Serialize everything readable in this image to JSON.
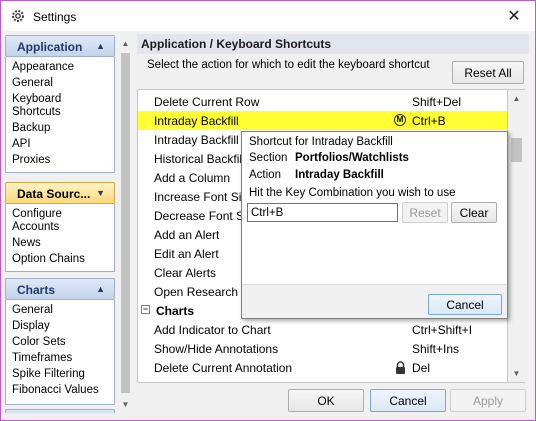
{
  "window": {
    "title": "Settings",
    "close_glyph": "✕",
    "icon": "gear-settings-icon"
  },
  "sidebar": {
    "groups": [
      {
        "label": "Application",
        "arrow": "▲",
        "items": [
          "Appearance",
          "General",
          "Keyboard\nShortcuts",
          "Backup",
          "API",
          "Proxies"
        ]
      },
      {
        "label": "Data Sourc...",
        "arrow": "▼",
        "active": true,
        "items": [
          "Configure\nAccounts",
          "News",
          "Option Chains"
        ]
      },
      {
        "label": "Charts",
        "arrow": "▲",
        "items": [
          "General",
          "Display",
          "Color Sets",
          "Timeframes",
          "Spike Filtering",
          "Fibonacci Values"
        ]
      }
    ]
  },
  "main": {
    "header": "Application / Keyboard Shortcuts",
    "instruction": "Select the action for which to edit the keyboard shortcut",
    "reset_all_label": "Reset All"
  },
  "shortcuts": {
    "rows": [
      {
        "name": "Delete Current Row",
        "key": "Shift+Del"
      },
      {
        "name": "Intraday Backfill",
        "key": "Ctrl+B",
        "selected": true,
        "icon": "M"
      },
      {
        "name": "Intraday Backfill",
        "key": ""
      },
      {
        "name": "Historical Backfill",
        "key": ""
      },
      {
        "name": "Add a Column",
        "key": ""
      },
      {
        "name": "Increase Font Size",
        "key": ""
      },
      {
        "name": "Decrease Font Size",
        "key": ""
      },
      {
        "name": "Add an Alert",
        "key": ""
      },
      {
        "name": "Edit an Alert",
        "key": ""
      },
      {
        "name": "Clear Alerts",
        "key": ""
      },
      {
        "name": "Open Research",
        "key": ""
      },
      {
        "name": "Charts",
        "key": "",
        "group": true,
        "expander": "⊟"
      },
      {
        "name": "Add Indicator to Chart",
        "key": "Ctrl+Shift+I"
      },
      {
        "name": "Show/Hide Annotations",
        "key": "Shift+Ins"
      },
      {
        "name": "Delete Current Annotation",
        "key": "Del",
        "locked": true
      }
    ]
  },
  "popup": {
    "title": "Shortcut for Intraday Backfill",
    "section_label": "Section",
    "section_value": "Portfolios/Watchlists",
    "action_label": "Action",
    "action_value": "Intraday Backfill",
    "hint": "Hit the Key Combination you wish to use",
    "input_value": "Ctrl+B",
    "reset_label": "Reset",
    "clear_label": "Clear",
    "cancel_label": "Cancel"
  },
  "footer": {
    "ok_label": "OK",
    "cancel_label": "Cancel",
    "apply_label": "Apply"
  },
  "colors": {
    "selected_row": "#ffff33",
    "header_bg": "#e1e6ee",
    "active_group": "#ffd97a",
    "window_border": "#b95bc8"
  }
}
